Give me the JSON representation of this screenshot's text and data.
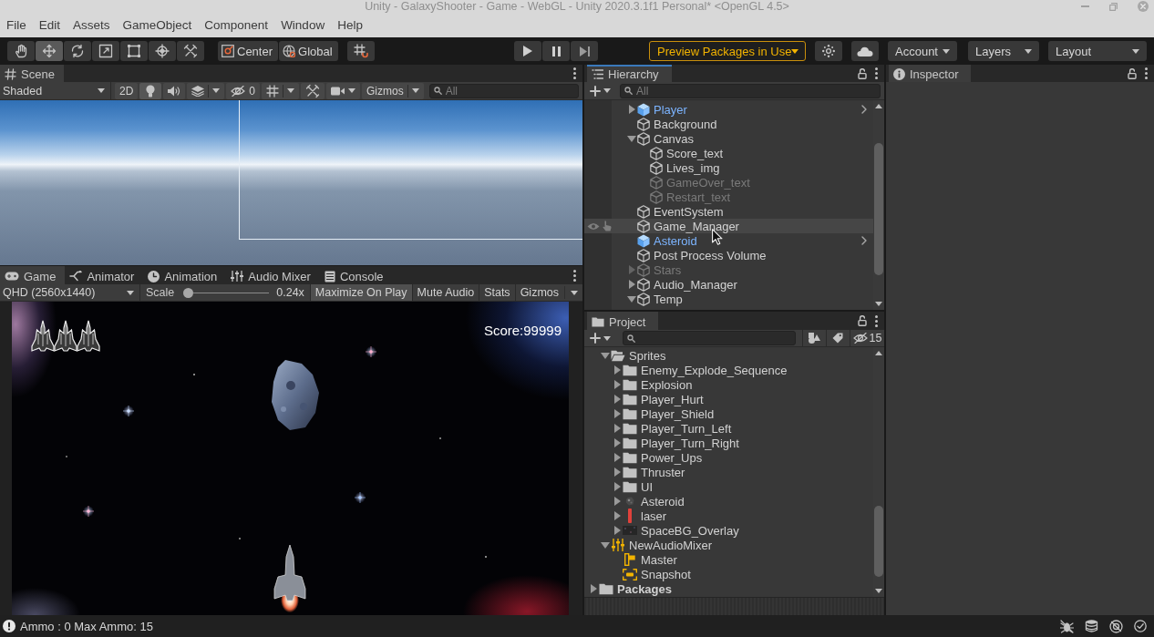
{
  "window": {
    "title": "Unity - GalaxyShooter - Game - WebGL - Unity 2020.3.1f1 Personal* <OpenGL 4.5>"
  },
  "menu": [
    "File",
    "Edit",
    "Assets",
    "GameObject",
    "Component",
    "Window",
    "Help"
  ],
  "toolbar": {
    "tools": [
      {
        "kind": "hand",
        "selected": false
      },
      {
        "kind": "move",
        "selected": true
      },
      {
        "kind": "rotate",
        "selected": false
      },
      {
        "kind": "scale",
        "selected": false
      },
      {
        "kind": "rect",
        "selected": false
      },
      {
        "kind": "transform",
        "selected": false
      },
      {
        "kind": "custom",
        "selected": false
      }
    ],
    "pivot_mode": "Center",
    "pivot_space": "Global",
    "preview_packages": "Preview Packages in Use",
    "dropdowns": [
      "Account",
      "Layers",
      "Layout"
    ]
  },
  "scene": {
    "tab": {
      "label": "Scene",
      "selected": true
    },
    "focused": false,
    "toolbar": {
      "draw_mode": "Shaded",
      "mode_2d": "2D",
      "hidden_count": "0",
      "gizmos": "Gizmos",
      "search_placeholder": "All"
    }
  },
  "game": {
    "tabs": [
      {
        "kind": "game",
        "label": "Game",
        "selected": true
      },
      {
        "kind": "animator",
        "label": "Animator",
        "selected": false
      },
      {
        "kind": "animation",
        "label": "Animation",
        "selected": false
      },
      {
        "kind": "mixer",
        "label": "Audio Mixer",
        "selected": false
      },
      {
        "kind": "console",
        "label": "Console",
        "selected": false
      }
    ],
    "focused": false,
    "toolbar": {
      "resolution": "QHD (2560x1440)",
      "scale_label": "Scale",
      "scale": {
        "level": 0
      },
      "scale_reading": "0.24x",
      "toggles": [
        {
          "label": "Maximize On Play",
          "on": true
        },
        {
          "label": "Mute Audio",
          "on": false
        },
        {
          "label": "Stats",
          "on": false
        }
      ],
      "gizmos": "Gizmos"
    },
    "view": {
      "score": "Score:99999"
    }
  },
  "hierarchy": {
    "tab": {
      "label": "Hierarchy",
      "selected": true
    },
    "focused": true,
    "search_placeholder": "All",
    "items": [
      {
        "name": "Player",
        "kind": "prefab",
        "active": true,
        "hovered": false,
        "expandable": true,
        "expanded": false
      },
      {
        "name": "Background",
        "kind": "object",
        "active": true,
        "hovered": false,
        "expandable": false,
        "expanded": false
      },
      {
        "name": "Canvas",
        "kind": "object",
        "active": true,
        "hovered": false,
        "expandable": true,
        "expanded": true,
        "children": [
          {
            "name": "Score_text",
            "kind": "object",
            "active": true,
            "hovered": false,
            "expandable": false,
            "expanded": false
          },
          {
            "name": "Lives_img",
            "kind": "object",
            "active": true,
            "hovered": false,
            "expandable": false,
            "expanded": false
          },
          {
            "name": "GameOver_text",
            "kind": "object",
            "active": false,
            "hovered": false,
            "expandable": false,
            "expanded": false
          },
          {
            "name": "Restart_text",
            "kind": "object",
            "active": false,
            "hovered": false,
            "expandable": false,
            "expanded": false
          }
        ]
      },
      {
        "name": "EventSystem",
        "kind": "object",
        "active": true,
        "hovered": false,
        "expandable": false,
        "expanded": false
      },
      {
        "name": "Game_Manager",
        "kind": "object",
        "active": true,
        "hovered": true,
        "expandable": false,
        "expanded": false
      },
      {
        "name": "Asteroid",
        "kind": "prefab",
        "active": true,
        "hovered": false,
        "expandable": false,
        "expanded": false
      },
      {
        "name": "Post Process Volume",
        "kind": "object",
        "active": true,
        "hovered": false,
        "expandable": false,
        "expanded": false
      },
      {
        "name": "Stars",
        "kind": "object",
        "active": false,
        "hovered": false,
        "expandable": true,
        "expanded": false
      },
      {
        "name": "Audio_Manager",
        "kind": "object",
        "active": true,
        "hovered": false,
        "expandable": true,
        "expanded": false
      },
      {
        "name": "Temp",
        "kind": "object",
        "active": true,
        "hovered": false,
        "expandable": true,
        "expanded": true
      }
    ]
  },
  "project": {
    "tab": {
      "label": "Project",
      "selected": true
    },
    "focused": false,
    "hidden_count": "15",
    "items": [
      {
        "children": [
          {
            "name": "Sprites",
            "kind": "folder",
            "expandable": true,
            "expanded": true,
            "children": [
              {
                "name": "Enemy_Explode_Sequence",
                "kind": "folder",
                "expandable": true,
                "expanded": false
              },
              {
                "name": "Explosion",
                "kind": "folder",
                "expandable": true,
                "expanded": false
              },
              {
                "name": "Player_Hurt",
                "kind": "folder",
                "expandable": true,
                "expanded": false
              },
              {
                "name": "Player_Shield",
                "kind": "folder",
                "expandable": true,
                "expanded": false
              },
              {
                "name": "Player_Turn_Left",
                "kind": "folder",
                "expandable": true,
                "expanded": false
              },
              {
                "name": "Player_Turn_Right",
                "kind": "folder",
                "expandable": true,
                "expanded": false
              },
              {
                "name": "Power_Ups",
                "kind": "folder",
                "expandable": true,
                "expanded": false
              },
              {
                "name": "Thruster",
                "kind": "folder",
                "expandable": true,
                "expanded": false
              },
              {
                "name": "UI",
                "kind": "folder",
                "expandable": true,
                "expanded": false
              },
              {
                "name": "Asteroid",
                "kind": "texture",
                "expandable": true,
                "expanded": false
              },
              {
                "name": "laser",
                "kind": "texture",
                "expandable": true,
                "expanded": false
              },
              {
                "name": "SpaceBG_Overlay",
                "kind": "texture",
                "expandable": true,
                "expanded": false
              }
            ]
          },
          {
            "name": "NewAudioMixer",
            "kind": "mixer",
            "expandable": true,
            "expanded": true,
            "children": [
              {
                "name": "Master",
                "kind": "group",
                "expandable": false,
                "expanded": false
              },
              {
                "name": "Snapshot",
                "kind": "snapshot",
                "expandable": false,
                "expanded": false
              }
            ]
          }
        ]
      },
      {
        "name": "Packages",
        "kind": "folder",
        "expandable": true,
        "expanded": false
      }
    ]
  },
  "inspector": {
    "tab": {
      "label": "Inspector",
      "selected": true
    },
    "focused": false
  },
  "status_bar": {
    "message": "Ammo : 0 Max Ammo: 15"
  }
}
